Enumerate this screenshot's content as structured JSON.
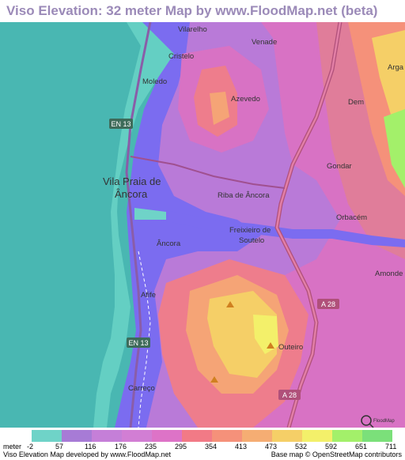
{
  "title": "Viso Elevation: 32 meter Map by www.FloodMap.net (beta)",
  "map": {
    "places": [
      {
        "name": "Vilarelho",
        "big": false
      },
      {
        "name": "Venade",
        "big": false
      },
      {
        "name": "Cristelo",
        "big": false
      },
      {
        "name": "Moledo",
        "big": false
      },
      {
        "name": "Azevedo",
        "big": false
      },
      {
        "name": "Dem",
        "big": false
      },
      {
        "name": "Arga",
        "big": false
      },
      {
        "name": "Gondar",
        "big": false
      },
      {
        "name": "Vila Praia de",
        "big": true
      },
      {
        "name": "Âncora",
        "big": true
      },
      {
        "name": "Riba de Âncora",
        "big": false
      },
      {
        "name": "Orbacém",
        "big": false
      },
      {
        "name": "Freixieiro de",
        "big": false
      },
      {
        "name": "Soutelo",
        "big": false
      },
      {
        "name": "Âncora",
        "big": false
      },
      {
        "name": "Amonde",
        "big": false
      },
      {
        "name": "Afife",
        "big": false
      },
      {
        "name": "Outeiro",
        "big": false
      },
      {
        "name": "Carreço",
        "big": false
      }
    ],
    "road_shields": [
      "EN 13",
      "A 28",
      "EN 13",
      "A 28"
    ],
    "watermark": "FloodMap"
  },
  "legend": {
    "unit_label": "meter",
    "labels": [
      "-2",
      "57",
      "116",
      "176",
      "235",
      "295",
      "354",
      "413",
      "473",
      "532",
      "592",
      "651",
      "711"
    ],
    "colors": [
      "#6fd3c8",
      "#7b6cf0",
      "#a77bd6",
      "#c57fd8",
      "#d27ed4",
      "#dd73c7",
      "#f27a86",
      "#f5917a",
      "#f5ad73",
      "#f5cf67",
      "#f3f06a",
      "#a3f06a",
      "#7be07a"
    ]
  },
  "footer": {
    "left": "Viso Elevation Map developed by www.FloodMap.net",
    "right": "Base map © OpenStreetMap contributors"
  },
  "colors": {
    "sea": "#49b7b2",
    "low": "#7b6cf0",
    "mid": "#c46fd4",
    "high": "#e87aa0",
    "peak": "#f5d96a"
  }
}
